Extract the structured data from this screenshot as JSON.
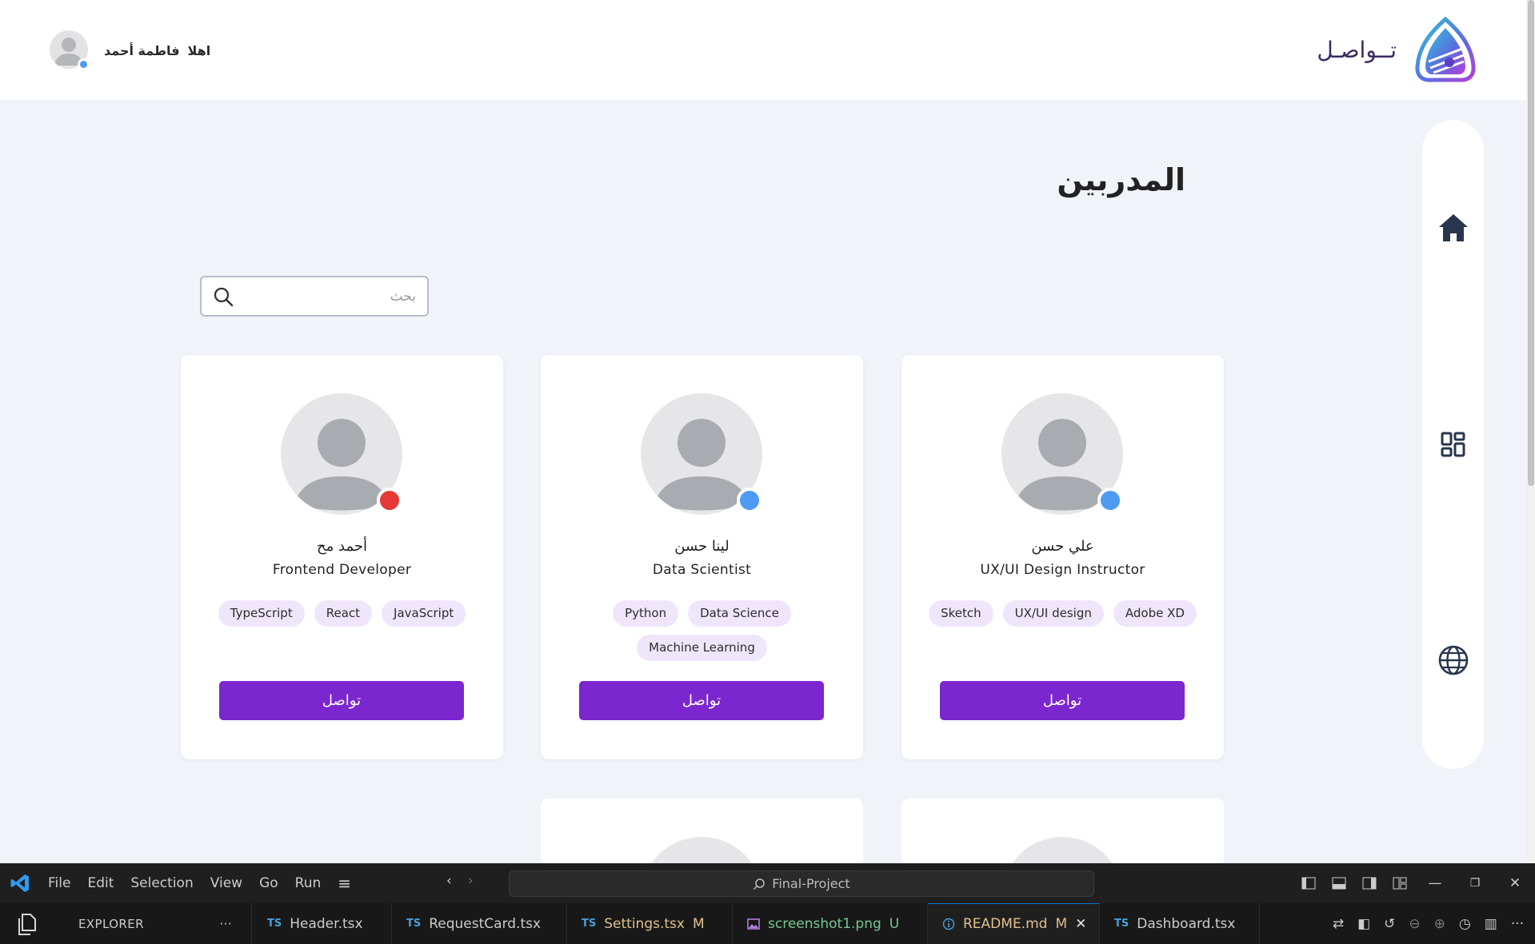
{
  "header": {
    "greeting_word": "اهلا",
    "user_name": "فاطمة أحمد",
    "brand_name": "تــواصـل"
  },
  "page": {
    "title": "المدربين",
    "search_placeholder": "بحث"
  },
  "colors": {
    "primary": "#7b26cf",
    "tag_bg": "#efe6fb",
    "status_online": "#4f9bf4",
    "status_busy": "#e53935",
    "page_bg": "#f0f3f8"
  },
  "sidenav": {
    "icons": [
      "home-icon",
      "dashboard-icon",
      "globe-icon"
    ]
  },
  "trainers": [
    {
      "name": "علي حسن",
      "role": "UX/UI Design Instructor",
      "tags": [
        "Sketch",
        "UX/UI design",
        "Adobe XD"
      ],
      "status": "online",
      "button": "تواصل"
    },
    {
      "name": "لينا حسن",
      "role": "Data Scientist",
      "tags": [
        "Python",
        "Data Science",
        "Machine Learning"
      ],
      "status": "online",
      "button": "تواصل"
    },
    {
      "name": "أحمد مح",
      "role": "Frontend Developer",
      "tags": [
        "TypeScript",
        "React",
        "JavaScript"
      ],
      "status": "busy",
      "button": "تواصل"
    }
  ],
  "vscode": {
    "menu": [
      "File",
      "Edit",
      "Selection",
      "View",
      "Go",
      "Run"
    ],
    "command_center": "Final-Project",
    "explorer_label": "EXPLORER",
    "tabs": [
      {
        "badge": "TS",
        "label": "Header.tsx",
        "status": ""
      },
      {
        "badge": "TS",
        "label": "RequestCard.tsx",
        "status": ""
      },
      {
        "badge": "TS",
        "label": "Settings.tsx",
        "status": "M"
      },
      {
        "badge": "img",
        "label": "screenshot1.png",
        "status": "U"
      },
      {
        "badge": "info",
        "label": "README.md",
        "status": "M"
      },
      {
        "badge": "TS",
        "label": "Dashboard.tsx",
        "status": ""
      }
    ]
  }
}
